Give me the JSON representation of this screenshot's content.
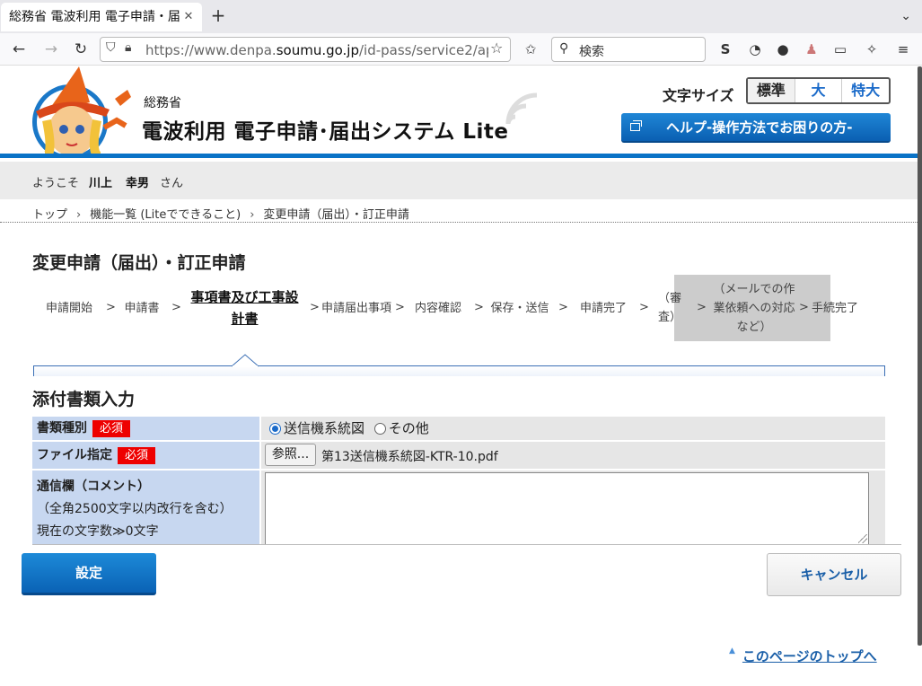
{
  "browser": {
    "tab_title": "総務省 電波利用 電子申請・届",
    "tab_close": "✕",
    "new_tab": "+",
    "url_prefix": "https://www.denpa.",
    "url_domain": "soumu.go.jp",
    "url_path": "/id-pass/service2/ap",
    "search_placeholder": "検索"
  },
  "header": {
    "ministry": "総務省",
    "title": "電波利用 電子申請･届出システム Lite",
    "font_size_label": "文字サイズ",
    "font_sizes": [
      "標準",
      "大",
      "特大"
    ],
    "help": "ヘルプ-操作方法でお困りの方-"
  },
  "welcome": {
    "prefix": "ようこそ",
    "last_name": "川上",
    "first_name": "幸男",
    "suffix": "さん"
  },
  "breadcrumb": [
    "トップ",
    "機能一覧 (Liteでできること)",
    "変更申請（届出）・訂正申請"
  ],
  "page_title": "変更申請（届出）・訂正申請",
  "steps": {
    "items": [
      "申請開始",
      "申請書",
      "事項書及び工事設計書",
      "申請届出事項",
      "内容確認",
      "保存・送信",
      "申請完了",
      "（審査）",
      "（メールでの作業依頼への対応など）",
      "手続完了"
    ],
    "current_index": 2,
    "arrow": ">"
  },
  "section_title": "添付書類入力",
  "form": {
    "required_badge": "必須",
    "doc_type_label": "書類種別",
    "doc_type_options": [
      "送信機系統図",
      "その他"
    ],
    "doc_type_selected": "送信機系統図",
    "file_label": "ファイル指定",
    "browse_label": "参照...",
    "file_name": "第13送信機系統図-KTR-10.pdf",
    "comment_label": "通信欄（コメント）",
    "comment_note": "（全角2500文字以内改行を含む）",
    "comment_count": "現在の文字数≫0文字",
    "comment_value": ""
  },
  "buttons": {
    "set": "設定",
    "cancel": "キャンセル"
  },
  "page_top": "このページのトップへ"
}
